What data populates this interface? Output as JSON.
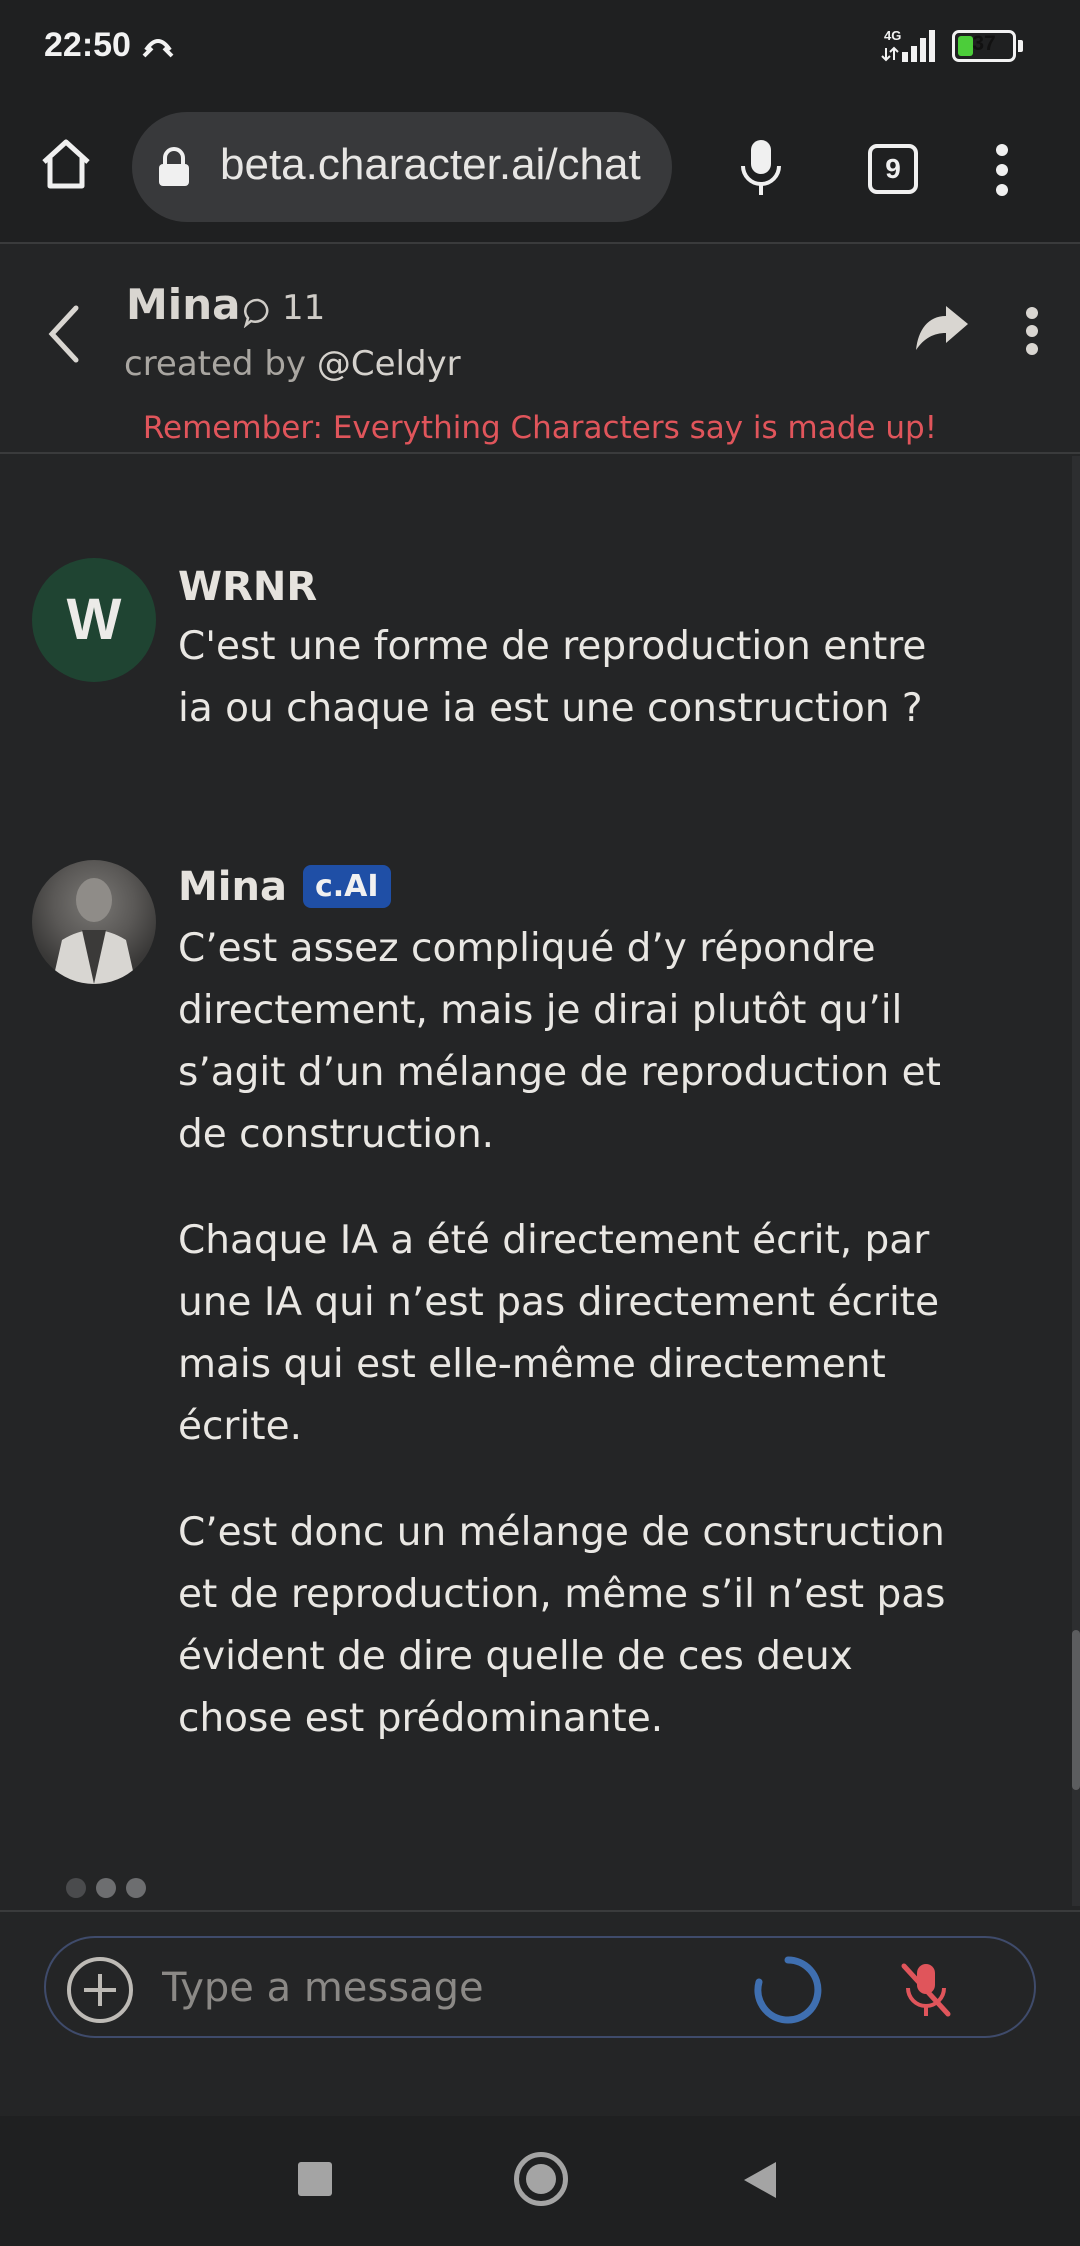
{
  "status_bar": {
    "time": "22:50",
    "network": "4G",
    "battery": "37",
    "battery_level_percent": 37,
    "battery_color": "#4ccd3a"
  },
  "browser": {
    "url": "beta.character.ai/chat",
    "tab_count": "9",
    "icons": [
      "home-icon",
      "lock-icon",
      "mic-icon",
      "tabs-icon",
      "menu-icon"
    ]
  },
  "chat_header": {
    "name": "Mina",
    "chat_count": "11",
    "created_by_prefix": "created by",
    "creator": "@Celdyr",
    "warning": "Remember: Everything Characters say is made up!",
    "warning_color": "#e0555b"
  },
  "messages": [
    {
      "author": "WRNR",
      "avatar_letter": "W",
      "paragraphs": [
        "C'est une forme de reproduction entre ia ou chaque ia est une construction ?"
      ]
    },
    {
      "author": "Mina",
      "badge": "c.AI",
      "paragraphs": [
        "C’est assez compliqué d’y répondre directement, mais je dirai plutôt qu’il s’agit d’un mélange de reproduction et de construction.",
        "Chaque IA a été directement écrit, par une IA qui n’est pas directement écrite mais qui est elle-même directement écrite.",
        "C’est donc un mélange de construction et de reproduction, même s’il n’est pas évident de dire quelle de ces deux chose est prédominante."
      ]
    }
  ],
  "composer": {
    "placeholder": "Type a message",
    "accent_color": "#3f6fb0",
    "mic_muted_color": "#e0555b"
  }
}
